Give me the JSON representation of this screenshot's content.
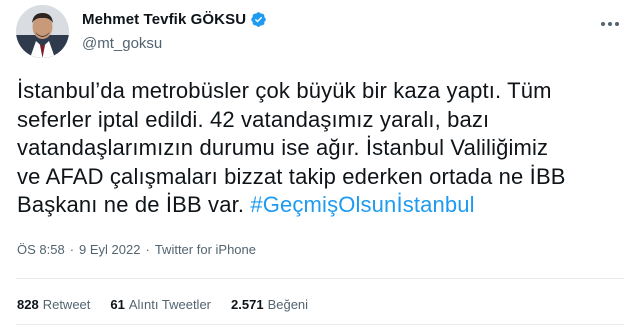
{
  "author": {
    "display_name": "Mehmet Tevfik GÖKSU",
    "handle": "@mt_goksu",
    "verified": true
  },
  "tweet": {
    "lines": [
      "İstanbul’da metrobüsler çok büyük bir kaza yaptı. Tüm",
      "seferler iptal edildi. 42 vatandaşımız yaralı, bazı",
      "vatandaşlarımızın durumu ise ağır. İstanbul Valiliğimiz",
      "ve AFAD çalışmaları bizzat takip ederken ortada ne İBB"
    ],
    "last_line_prefix": "Başkanı ne de İBB var. ",
    "hashtag": "#GeçmişOlsunİstanbul"
  },
  "meta": {
    "time": "ÖS 8:58",
    "separator": "·",
    "date": "9 Eyl 2022",
    "source": "Twitter for iPhone"
  },
  "stats": {
    "retweets": {
      "count": "828",
      "label": "Retweet"
    },
    "quotes": {
      "count": "61",
      "label": "Alıntı Tweetler"
    },
    "likes": {
      "count": "2.571",
      "label": "Beğeni"
    }
  },
  "colors": {
    "accent": "#1d9bf0",
    "text": "#0f1419",
    "secondary": "#536471"
  },
  "icons": {
    "verified": "verified-badge-icon",
    "more": "more-options-icon"
  }
}
